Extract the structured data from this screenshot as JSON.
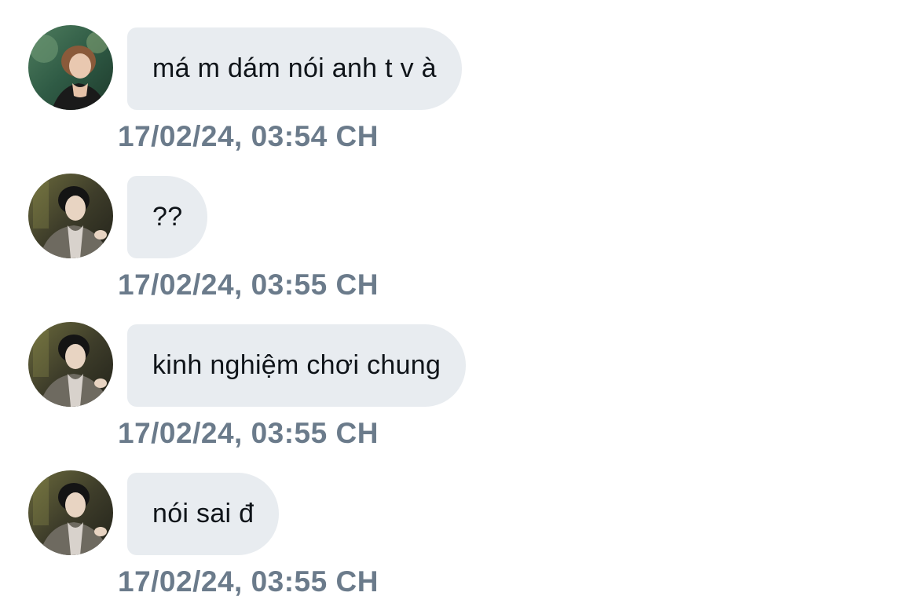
{
  "colors": {
    "bubble_bg": "#e8ecf0",
    "message_text": "#0f1419",
    "timestamp_text": "#6b7b8b"
  },
  "messages": [
    {
      "avatar": "user-photo-avatar-green",
      "text": "má m dám nói anh t v à",
      "timestamp": "17/02/24, 03:54 CH"
    },
    {
      "avatar": "user-photo-avatar-dark",
      "text": "??",
      "timestamp": "17/02/24, 03:55 CH"
    },
    {
      "avatar": "user-photo-avatar-dark",
      "text": "kinh nghiệm chơi chung",
      "timestamp": "17/02/24, 03:55 CH"
    },
    {
      "avatar": "user-photo-avatar-dark",
      "text": "nói sai đ",
      "timestamp": "17/02/24, 03:55 CH"
    }
  ]
}
